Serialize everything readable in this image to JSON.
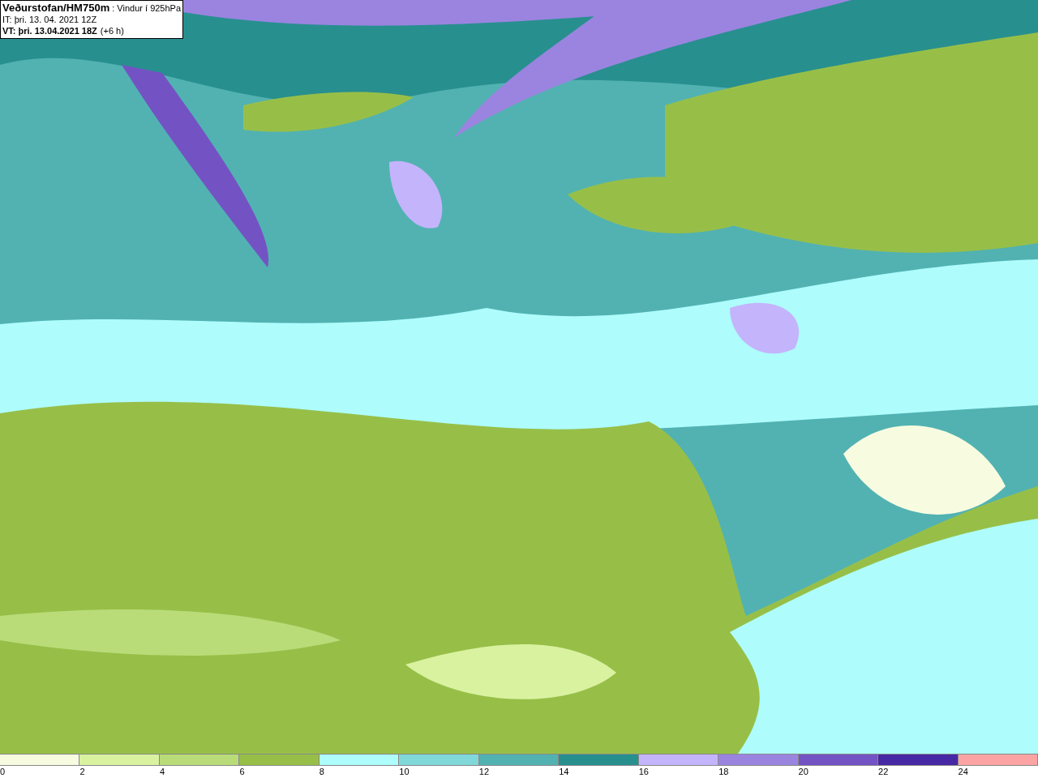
{
  "header": {
    "title": "Veðurstofan/HM750m",
    "subtitle": " : Vindur í 925hPa",
    "issue_time": "IT: þri. 13. 04. 2021 12Z",
    "valid_time": "VT: þri. 13.04.2021 18Z",
    "offset": "(+6 h)"
  },
  "legend": {
    "segments": [
      {
        "color": "#f7fce0"
      },
      {
        "color": "#d9f2a0"
      },
      {
        "color": "#b9dc78"
      },
      {
        "color": "#97bf48"
      },
      {
        "color": "#aefcfc"
      },
      {
        "color": "#80d8d8"
      },
      {
        "color": "#52b2b2"
      },
      {
        "color": "#288f8f"
      },
      {
        "color": "#c4b4fc"
      },
      {
        "color": "#9a84e0"
      },
      {
        "color": "#7353c4"
      },
      {
        "color": "#4628a4"
      },
      {
        "color": "#fca4a4"
      }
    ],
    "labels": [
      "0",
      "2",
      "4",
      "6",
      "8",
      "10",
      "12",
      "14",
      "16",
      "18",
      "20",
      "22",
      "24"
    ]
  }
}
